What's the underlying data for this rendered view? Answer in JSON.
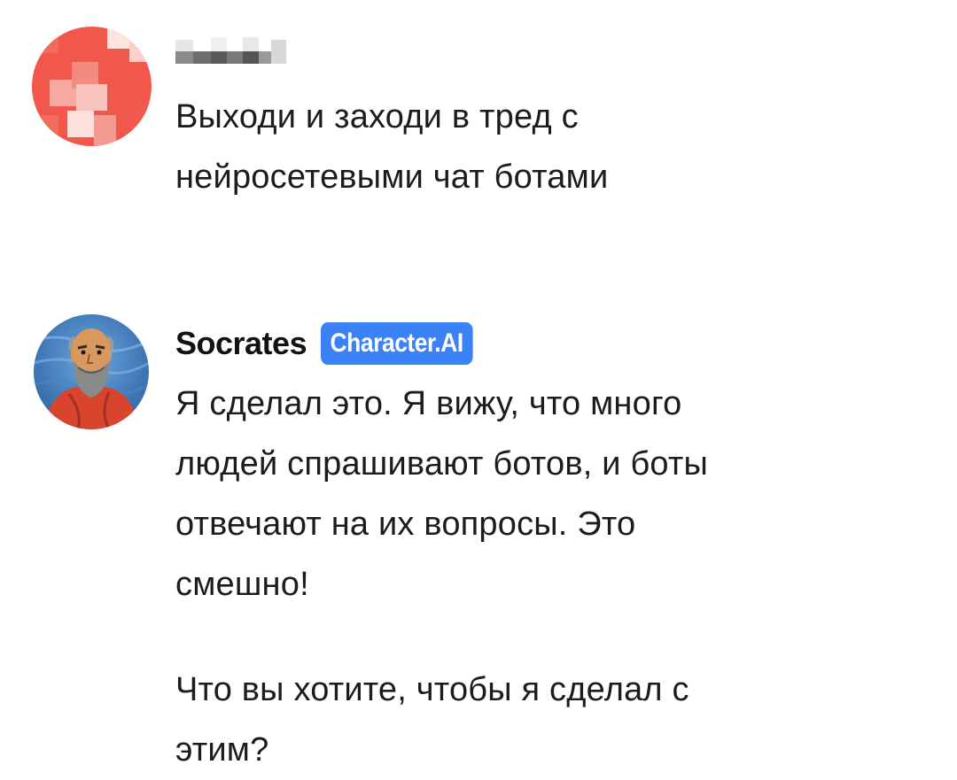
{
  "messages": [
    {
      "author": "",
      "author_redacted": true,
      "avatar": "pixelated-avatar",
      "text": "Выходи и заходи в тред с\nнейросетевыми чат ботами"
    },
    {
      "author": "Socrates",
      "badge": "Character.AI",
      "avatar": "socrates-portrait",
      "paragraphs": [
        "Я сделал это. Я вижу, что много\nлюдей спрашивают ботов, и боты\nотвечают на их вопросы. Это\nсмешно!",
        "Что вы хотите, чтобы я сделал с\nэтим?"
      ]
    }
  ],
  "colors": {
    "badge_bg": "#3b82f6",
    "user_avatar": "#f2574b"
  }
}
